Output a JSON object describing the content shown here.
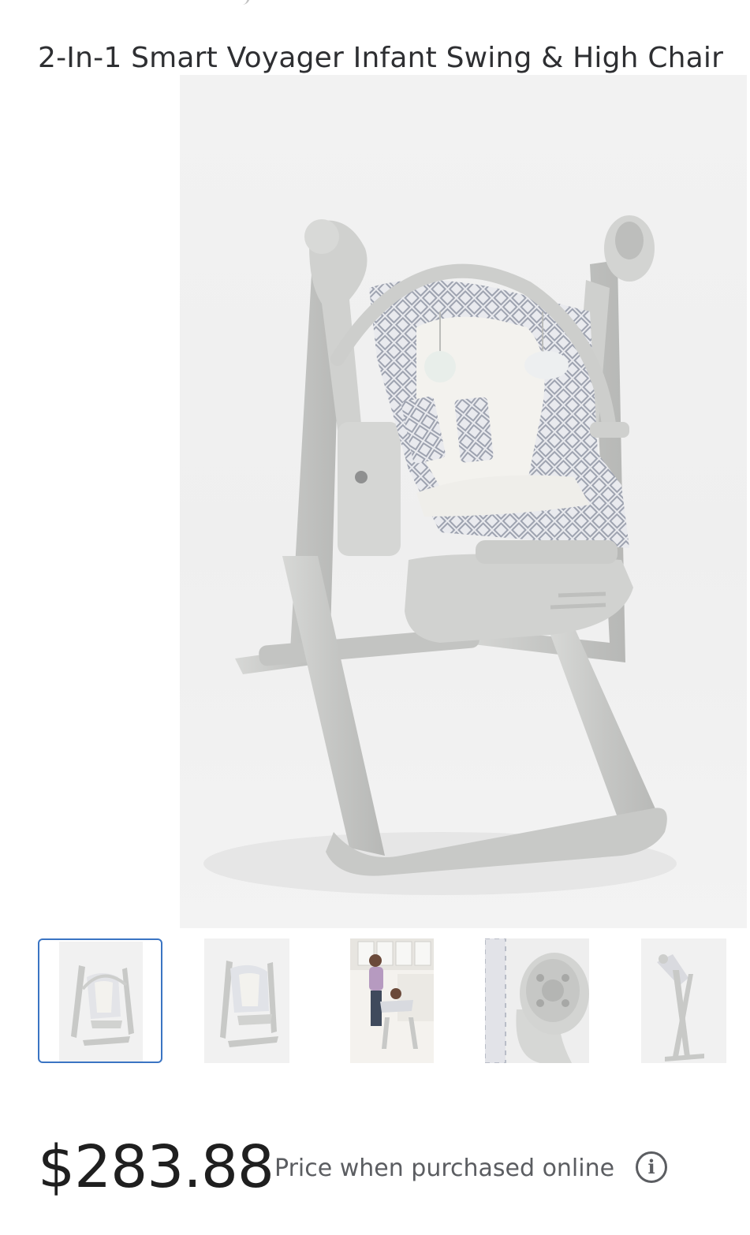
{
  "product": {
    "title": "2-In-1 Smart Voyager Infant Swing & High Chair",
    "main_image_alt": "2-In-1 Smart Voyager Infant Swing & High Chair in grey with diamond pattern seat pad"
  },
  "gallery": {
    "selected_index": 0,
    "thumbnails": [
      {
        "alt": "Swing front view",
        "icon": "swing-front-thumbnail"
      },
      {
        "alt": "Swing angled view",
        "icon": "swing-angled-thumbnail"
      },
      {
        "alt": "Parent with baby in high chair in kitchen",
        "icon": "lifestyle-thumbnail"
      },
      {
        "alt": "Control panel close-up",
        "icon": "control-panel-thumbnail"
      },
      {
        "alt": "Swing side view",
        "icon": "swing-side-thumbnail"
      }
    ]
  },
  "pricing": {
    "price": "$283.88",
    "note": "Price when purchased online",
    "info_icon": "info-icon"
  },
  "colors": {
    "selected_border": "#3a74c3",
    "frame_grey": "#c9cac8",
    "text_primary": "#2e2f32",
    "text_secondary": "#5b5d61"
  }
}
